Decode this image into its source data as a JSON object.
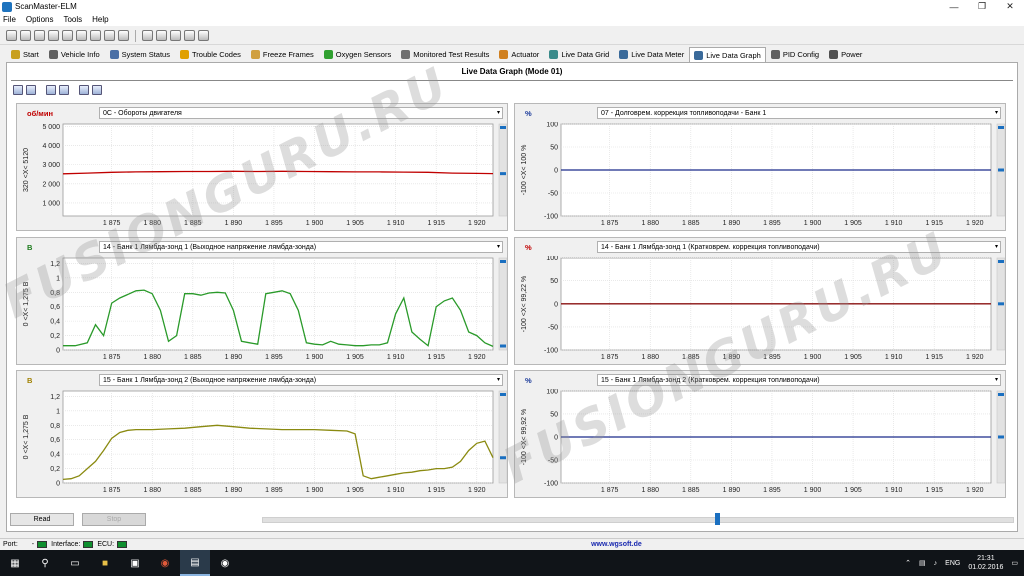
{
  "window": {
    "title": "ScanMaster-ELM"
  },
  "menu": [
    "File",
    "Options",
    "Tools",
    "Help"
  ],
  "tabs": [
    {
      "label": "Start",
      "icon": "key-icon",
      "color": "#c8a020"
    },
    {
      "label": "Vehicle Info",
      "icon": "car-icon",
      "color": "#606060"
    },
    {
      "label": "System Status",
      "icon": "monitor-icon",
      "color": "#4a6fa5"
    },
    {
      "label": "Trouble Codes",
      "icon": "warning-icon",
      "color": "#e0a000"
    },
    {
      "label": "Freeze Frames",
      "icon": "snowflake-icon",
      "color": "#d0a040"
    },
    {
      "label": "Oxygen Sensors",
      "icon": "sensor-icon",
      "color": "#30a030"
    },
    {
      "label": "Monitored Test Results",
      "icon": "gauge-icon",
      "color": "#707070"
    },
    {
      "label": "Actuator",
      "icon": "actuator-icon",
      "color": "#d08020"
    },
    {
      "label": "Live Data Grid",
      "icon": "grid-icon",
      "color": "#3a8a8a"
    },
    {
      "label": "Live Data Meter",
      "icon": "meter-icon",
      "color": "#3a6a9a"
    },
    {
      "label": "Live Data Graph",
      "icon": "graph-icon",
      "color": "#3a6a9a"
    },
    {
      "label": "PID Config",
      "icon": "config-icon",
      "color": "#606060"
    },
    {
      "label": "Power",
      "icon": "power-icon",
      "color": "#505050"
    }
  ],
  "active_tab": "Live Data Graph",
  "panel": {
    "title": "Live Data Graph (Mode 01)"
  },
  "graphs": [
    {
      "unit": "об/мин",
      "unit_color": "#c00000",
      "pid": "0C - Обороты двигателя",
      "range_label": "320 <X< 5120",
      "y_ticks": [
        "5 000",
        "4 000",
        "3 000",
        "2 000",
        "1 000"
      ],
      "line_color": "#c00000"
    },
    {
      "unit": "%",
      "unit_color": "#1a3a9a",
      "pid": "07 - Долговрем. коррекция топливоподачи - Банк 1",
      "range_label": "-100 <X< 100 %",
      "y_ticks": [
        "100",
        "50",
        "0",
        "-50",
        "-100"
      ],
      "line_color": "#1a2a8a"
    },
    {
      "unit": "В",
      "unit_color": "#1a7a1a",
      "pid": "14 - Банк 1 Лямбда-зонд 1 (Выходное напряжение лямбда-зонда)",
      "range_label": "0 <X< 1,275 В",
      "y_ticks": [
        "1,2",
        "1",
        "0,8",
        "0,6",
        "0,4",
        "0,2",
        "0"
      ],
      "line_color": "#2a9a2a"
    },
    {
      "unit": "%",
      "unit_color": "#c00000",
      "pid": "14 - Банк 1 Лямбда-зонд 1 (Кратковрем. коррекция топливоподачи)",
      "range_label": "-100 <X< 99,22 %",
      "y_ticks": [
        "100",
        "50",
        "0",
        "-50",
        "-100"
      ],
      "line_color": "#8a1010"
    },
    {
      "unit": "В",
      "unit_color": "#a08000",
      "pid": "15 - Банк 1 Лямбда-зонд 2 (Выходное напряжение лямбда-зонда)",
      "range_label": "0 <X< 1,275 В",
      "y_ticks": [
        "1,2",
        "1",
        "0,8",
        "0,6",
        "0,4",
        "0,2",
        "0"
      ],
      "line_color": "#8a8a10"
    },
    {
      "unit": "%",
      "unit_color": "#1a3a9a",
      "pid": "15 - Банк 1 Лямбда-зонд 2 (Кратковрем. коррекция топливоподачи)",
      "range_label": "-100 <X< 99,92 %",
      "y_ticks": [
        "100",
        "50",
        "0",
        "-50",
        "-100"
      ],
      "line_color": "#1a2a8a"
    }
  ],
  "x_ticks": [
    "1 875",
    "1 880",
    "1 885",
    "1 890",
    "1 895",
    "1 900",
    "1 905",
    "1 910",
    "1 915",
    "1 920"
  ],
  "chart_data": [
    {
      "type": "line",
      "x": [
        1869,
        1872,
        1875,
        1878,
        1881,
        1884,
        1887,
        1890,
        1893,
        1896,
        1899,
        1902,
        1905,
        1908,
        1911,
        1914,
        1917,
        1920,
        1922
      ],
      "series": [
        {
          "values": [
            2520,
            2560,
            2600,
            2620,
            2630,
            2640,
            2640,
            2650,
            2640,
            2650,
            2640,
            2630,
            2620,
            2620,
            2610,
            2600,
            2560,
            2540,
            2530
          ]
        }
      ],
      "ylim": [
        320,
        5120
      ]
    },
    {
      "type": "line",
      "x": [
        1869,
        1922
      ],
      "series": [
        {
          "values": [
            0,
            0
          ]
        }
      ],
      "ylim": [
        -100,
        100
      ]
    },
    {
      "type": "line",
      "x": [
        1869,
        1870.5,
        1872,
        1873,
        1874,
        1875,
        1876,
        1878,
        1879,
        1880,
        1881,
        1882,
        1883,
        1884,
        1885,
        1886,
        1887,
        1888,
        1889,
        1890,
        1891,
        1892,
        1893,
        1894,
        1895,
        1896,
        1897,
        1898,
        1899,
        1900,
        1901,
        1902,
        1903,
        1904,
        1905,
        1906,
        1907,
        1908,
        1909,
        1910,
        1911,
        1912,
        1913,
        1914,
        1915,
        1916,
        1917,
        1918,
        1919,
        1920,
        1921,
        1922
      ],
      "series": [
        {
          "values": [
            0.06,
            0.06,
            0.1,
            0.35,
            0.2,
            0.65,
            0.72,
            0.82,
            0.83,
            0.78,
            0.55,
            0.12,
            0.2,
            0.78,
            0.78,
            0.76,
            0.79,
            0.8,
            0.79,
            0.55,
            0.12,
            0.1,
            0.08,
            0.78,
            0.8,
            0.82,
            0.78,
            0.55,
            0.1,
            0.08,
            0.07,
            0.12,
            0.08,
            0.07,
            0.06,
            0.06,
            0.07,
            0.07,
            0.1,
            0.5,
            0.72,
            0.25,
            0.15,
            0.06,
            0.6,
            0.68,
            0.72,
            0.55,
            0.25,
            0.2,
            0.1,
            0.05
          ]
        }
      ],
      "ylim": [
        0,
        1.275
      ]
    },
    {
      "type": "line",
      "x": [
        1869,
        1922
      ],
      "series": [
        {
          "values": [
            0,
            0
          ]
        }
      ],
      "ylim": [
        -100,
        99.22
      ]
    },
    {
      "type": "line",
      "x": [
        1869,
        1870,
        1871,
        1872,
        1873,
        1874,
        1875,
        1876,
        1877,
        1878,
        1879,
        1880,
        1882,
        1884,
        1886,
        1888,
        1890,
        1892,
        1894,
        1896,
        1898,
        1900,
        1902,
        1904,
        1905,
        1906,
        1907,
        1908,
        1909,
        1910,
        1911,
        1912,
        1913,
        1914,
        1915,
        1916,
        1917,
        1918,
        1919,
        1920,
        1921,
        1922
      ],
      "series": [
        {
          "values": [
            0.05,
            0.06,
            0.1,
            0.2,
            0.3,
            0.45,
            0.62,
            0.7,
            0.73,
            0.74,
            0.74,
            0.74,
            0.75,
            0.76,
            0.78,
            0.8,
            0.78,
            0.76,
            0.75,
            0.74,
            0.74,
            0.74,
            0.73,
            0.72,
            0.68,
            0.1,
            0.06,
            0.08,
            0.1,
            0.12,
            0.14,
            0.15,
            0.17,
            0.18,
            0.2,
            0.2,
            0.22,
            0.3,
            0.45,
            0.55,
            0.58,
            0.35
          ]
        }
      ],
      "ylim": [
        0,
        1.275
      ]
    },
    {
      "type": "line",
      "x": [
        1869,
        1922
      ],
      "series": [
        {
          "values": [
            0,
            0
          ]
        }
      ],
      "ylim": [
        -100,
        99.92
      ]
    }
  ],
  "buttons": {
    "read": "Read",
    "stop": "Stop"
  },
  "status": {
    "port": "Port:",
    "interface": "Interface:",
    "ecu": "ECU:",
    "url": "www.wgsoft.de"
  },
  "watermark": "FUSIONGURU.RU",
  "taskbar": {
    "lang": "ENG",
    "time": "21:31",
    "date": "01.02.2016"
  }
}
